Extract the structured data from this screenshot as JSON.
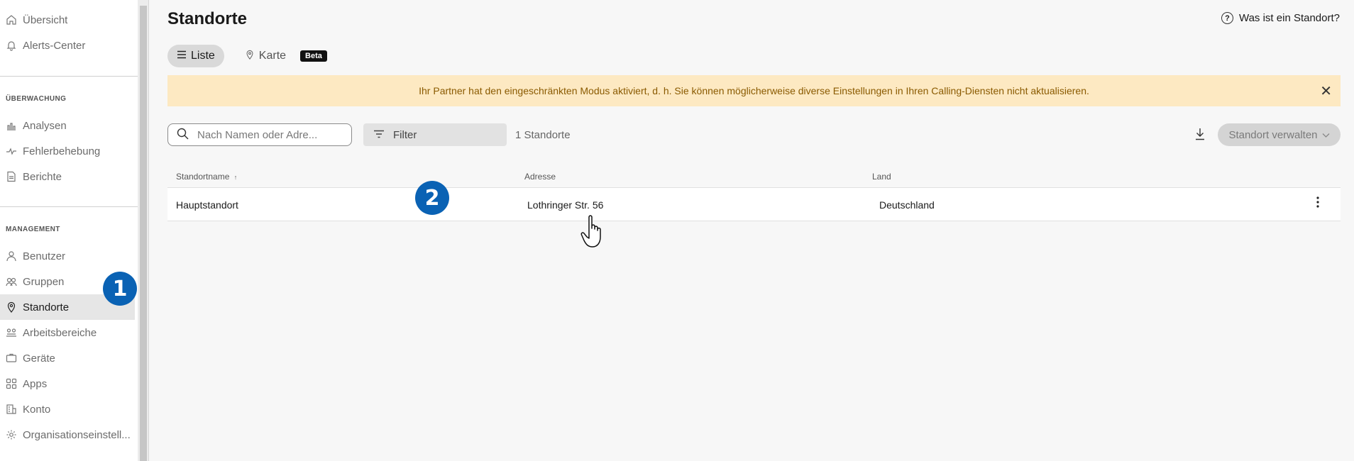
{
  "sidebar": {
    "top_items": [
      {
        "label": "Übersicht",
        "icon": "home-icon"
      },
      {
        "label": "Alerts-Center",
        "icon": "bell-icon"
      }
    ],
    "section_monitoring": "ÜBERWACHUNG",
    "monitoring_items": [
      {
        "label": "Analysen",
        "icon": "chart-icon"
      },
      {
        "label": "Fehlerbehebung",
        "icon": "pulse-icon"
      },
      {
        "label": "Berichte",
        "icon": "report-icon"
      }
    ],
    "section_management": "MANAGEMENT",
    "management_items": [
      {
        "label": "Benutzer",
        "icon": "user-icon"
      },
      {
        "label": "Gruppen",
        "icon": "group-icon"
      },
      {
        "label": "Standorte",
        "icon": "location-pin-icon",
        "active": true
      },
      {
        "label": "Arbeitsbereiche",
        "icon": "workspace-icon"
      },
      {
        "label": "Geräte",
        "icon": "device-icon"
      },
      {
        "label": "Apps",
        "icon": "apps-grid-icon"
      },
      {
        "label": "Konto",
        "icon": "building-icon"
      },
      {
        "label": "Organisationseinstell...",
        "icon": "gear-icon"
      }
    ]
  },
  "callouts": {
    "one": "1",
    "two": "2"
  },
  "page": {
    "title": "Standorte",
    "help_link": "Was ist ein Standort?"
  },
  "tabs": {
    "list": "Liste",
    "map": "Karte",
    "beta": "Beta"
  },
  "banner": {
    "text": "Ihr Partner hat den eingeschränkten Modus aktiviert, d. h. Sie können möglicherweise diverse Einstellungen in Ihren Calling-Diensten nicht aktualisieren."
  },
  "toolbar": {
    "search_placeholder": "Nach Namen oder Adre...",
    "filter_label": "Filter",
    "count": "1 Standorte",
    "manage_label": "Standort verwalten"
  },
  "table": {
    "headers": {
      "name": "Standortname",
      "sort": "↑",
      "address": "Adresse",
      "country": "Land"
    },
    "rows": [
      {
        "name": "Hauptstandort",
        "address": "Lothringer Str. 56",
        "country": "Deutschland"
      }
    ]
  },
  "colors": {
    "callout": "#0a62b4",
    "banner_bg": "#fde9c2",
    "banner_text": "#8a5a00"
  }
}
